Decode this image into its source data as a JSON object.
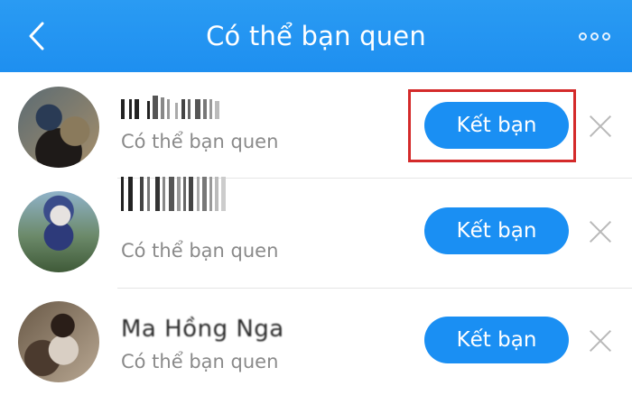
{
  "header": {
    "title": "Có thể bạn quen",
    "back_icon": "chevron-left-icon",
    "more_icon": "more-dots-icon",
    "background": "#1e8ff0"
  },
  "suggestions": [
    {
      "name": "",
      "subtitle": "Có thể bạn quen",
      "add_label": "Kết bạn",
      "close_icon": "close-icon"
    },
    {
      "name": "",
      "subtitle": "Có thể bạn quen",
      "add_label": "Kết bạn",
      "close_icon": "close-icon"
    },
    {
      "name": "Ma Hồng Nga",
      "subtitle": "Có thể bạn quen",
      "add_label": "Kết bạn",
      "close_icon": "close-icon"
    }
  ],
  "colors": {
    "button": "#1a8ff3",
    "highlight": "#d42a2a",
    "subtitle": "#8a8a8a"
  }
}
